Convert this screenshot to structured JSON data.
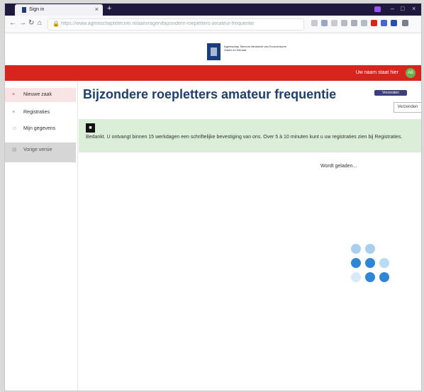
{
  "browser": {
    "tab_title": "Sign in",
    "new_tab": "+",
    "url": "https://www.agentschaptelecom.nl/aanvragen/bijzondere-roepletters-amateur-frequentie"
  },
  "header": {
    "logo_text": "Agentschap Telecom Ministerie van Economische Zaken en Klimaat"
  },
  "topbar": {
    "user_label": "Uw naam staat hier",
    "avatar_initials": "AB"
  },
  "sidebar": {
    "items": [
      {
        "label": "Nieuwe zaak",
        "icon": "plus-icon"
      },
      {
        "label": "Registraties",
        "icon": "list-icon"
      },
      {
        "label": "Mijn gegevens",
        "icon": "person-icon"
      },
      {
        "label": "Vorige versie",
        "icon": "document-icon"
      }
    ]
  },
  "main": {
    "title": "Bijzondere roepletters amateur frequentie",
    "badge_button": "Verzenden",
    "send_button": "Verzenden",
    "notice_text": "Bedankt. U ontvangt binnen 15 werkdagen een schriftelijke bevestiging van ons. Over 5 à 10 minuten kunt u uw registraties zien bij Registraties.",
    "loading_text": "Wordt geladen..."
  },
  "colors": {
    "brand_red": "#d5251d",
    "title_blue": "#203f6b",
    "notice_green": "#dbeed7",
    "spinner_blue": "#2f86d6"
  }
}
